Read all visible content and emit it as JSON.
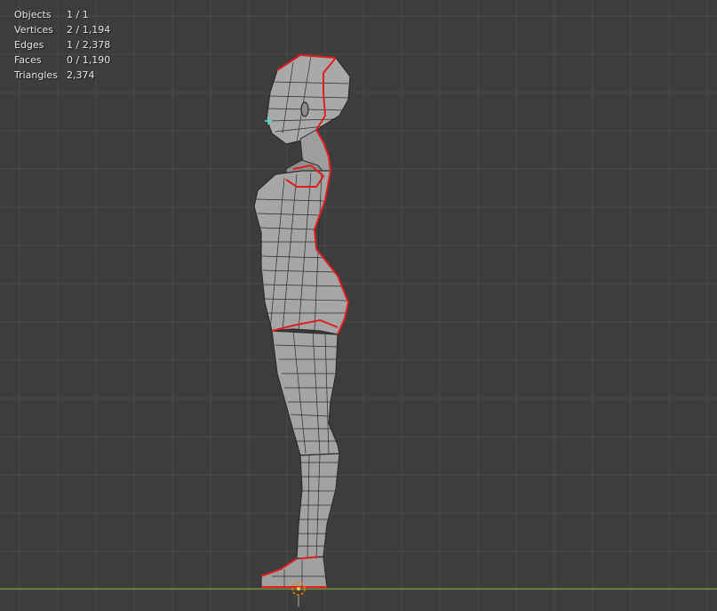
{
  "stats": [
    {
      "label": "Objects",
      "value": "1 / 1"
    },
    {
      "label": "Vertices",
      "value": "2 / 1,194"
    },
    {
      "label": "Edges",
      "value": "1 / 2,378"
    },
    {
      "label": "Faces",
      "value": "0 / 1,190"
    },
    {
      "label": "Triangles",
      "value": "2,374"
    }
  ],
  "colors": {
    "background": "#3d3d3d",
    "grid": "#4a4a4a",
    "ground_axis": "#6f8f3a",
    "mesh_fill": "#a8a8a8",
    "mesh_wire": "#2b2b2b",
    "selected_edge": "#e01e1e",
    "vertex_highlight": "#4fe0e0",
    "origin_cursor": "#ff7a00"
  },
  "icons": {
    "cursor": "3d-cursor-icon",
    "vertex": "selected-vertex-icon"
  }
}
